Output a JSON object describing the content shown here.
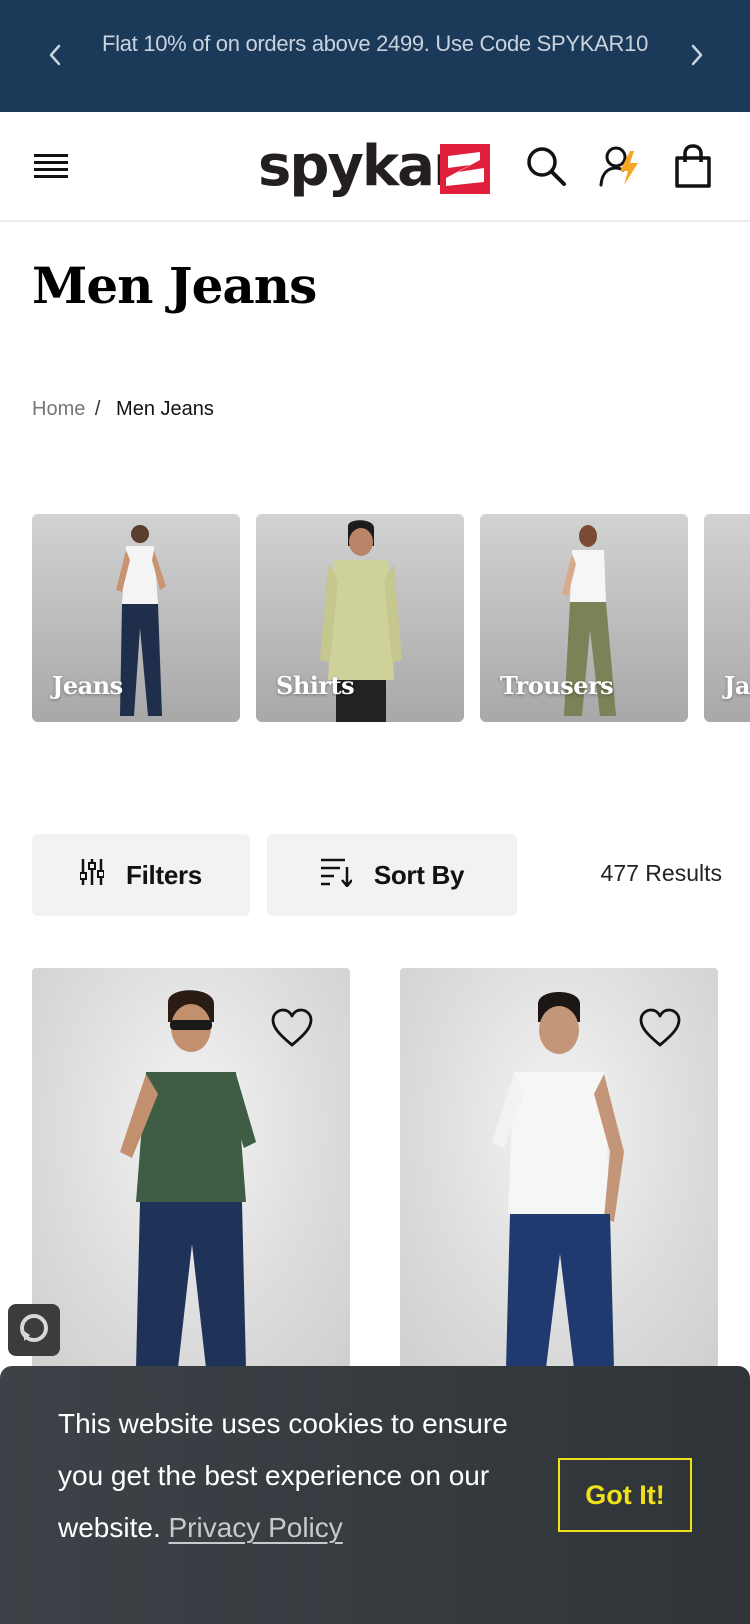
{
  "announcement": {
    "message": "Flat 10% of on orders above 2499. Use Code SPYKAR10",
    "prev_icon": "chevron-left-icon",
    "next_icon": "chevron-right-icon"
  },
  "header": {
    "brand": "spykar",
    "menu_icon": "hamburger-menu-icon",
    "search_icon": "search-icon",
    "account_icon": "account-icon",
    "cart_icon": "shopping-bag-icon"
  },
  "page": {
    "title": "Men Jeans"
  },
  "breadcrumb": {
    "home": "Home",
    "separator": "/",
    "current": "Men Jeans"
  },
  "categories": [
    {
      "label": "Jeans"
    },
    {
      "label": "Shirts"
    },
    {
      "label": "Trousers"
    },
    {
      "label": "Ja"
    }
  ],
  "controls": {
    "filters_label": "Filters",
    "sort_label": "Sort By",
    "results": "477 Results"
  },
  "cookie": {
    "message": "This website uses cookies to ensure you get the best experience on our website.",
    "policy_link": "Privacy Policy",
    "accept_label": "Got It!"
  },
  "colors": {
    "announcement_bg": "#1b3a5a",
    "brand_red": "#e0203a",
    "cookie_accent": "#f0e21a",
    "account_bolt": "#f5a623"
  }
}
